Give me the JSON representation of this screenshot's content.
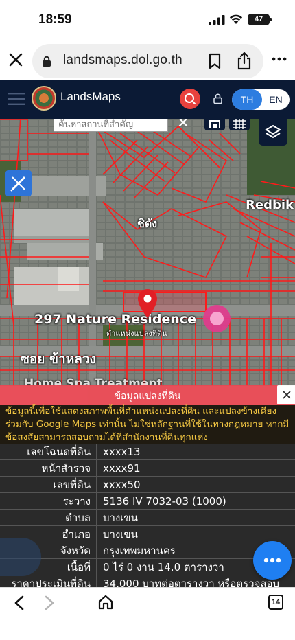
{
  "status_bar": {
    "time": "18:59",
    "battery": "47"
  },
  "browser": {
    "url": "landsmaps.dol.go.th",
    "tab_count": "14"
  },
  "app": {
    "brand": "LandsMaps",
    "lang_th": "TH",
    "lang_en": "EN"
  },
  "map": {
    "search_placeholder": "ค้นหาสถานที่สำคัญ",
    "labels": {
      "redbik": "Redbik",
      "road": "ชิตัง",
      "place": "297 Nature Residence",
      "place_sub": "ตำแหน่งแปลงที่ดิน",
      "soi": "ซอย ข้าหลวง",
      "spa": "Home Spa Treatment"
    }
  },
  "panel": {
    "title": "ข้อมูลแปลงที่ดิน",
    "notice": "ข้อมูลนี้เพื่อใช้แสดงสภาพพื้นที่ตำแหน่งแปลงที่ดิน และแปลงข้างเคียงร่วมกับ Google Maps เท่านั้น ไม่ใช่หลักฐานที่ใช้ในทางกฎหมาย หากมีข้อสงสัยสามารถสอบถามได้ที่สำนักงานที่ดินทุกแห่ง",
    "rows": [
      {
        "label": "เลขโฉนดที่ดิน",
        "value": "xxxx13"
      },
      {
        "label": "หน้าสำรวจ",
        "value": "xxxx91"
      },
      {
        "label": "เลขที่ดิน",
        "value": "xxxx50"
      },
      {
        "label": "ระวาง",
        "value": "5136 IV 7032-03 (1000)"
      },
      {
        "label": "ตำบล",
        "value": "บางเขน"
      },
      {
        "label": "อำเภอ",
        "value": "บางเขน"
      },
      {
        "label": "จังหวัด",
        "value": "กรุงเทพมหานคร"
      },
      {
        "label": "เนื้อที่",
        "value": "0 ไร่ 0 งาน 14.0 ตารางวา"
      },
      {
        "label": "ราคาประเมินที่ดิน",
        "value": "34,000 บาทต่อตารางวา หรือตรวจสอบ"
      }
    ]
  }
}
